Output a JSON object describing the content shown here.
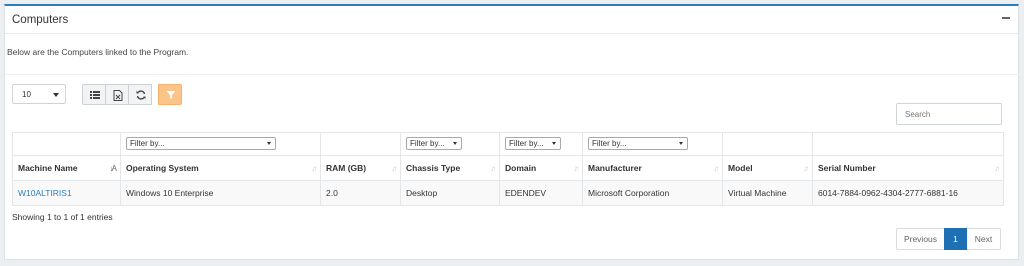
{
  "panel": {
    "title": "Computers",
    "intro": "Below are the Computers linked to the Program."
  },
  "toolbar": {
    "page_size": "10",
    "buttons": [
      "list-icon",
      "export-icon",
      "refresh-icon",
      "filter-icon"
    ],
    "filter_color": "#fbc58a"
  },
  "search": {
    "placeholder": "Search",
    "value": ""
  },
  "table": {
    "filters": [
      "",
      "Filter by...",
      "",
      "Filter by...",
      "Filter by...",
      "Filter by...",
      "",
      ""
    ],
    "columns": [
      "Machine Name",
      "Operating System",
      "RAM (GB)",
      "Chassis Type",
      "Domain",
      "Manufacturer",
      "Model",
      "Serial Number"
    ],
    "sorted_column": "Machine Name",
    "rows": [
      [
        "W10ALTIRIS1",
        "Windows 10 Enterprise",
        "2.0",
        "Desktop",
        "EDENDEV",
        "Microsoft Corporation",
        "Virtual Machine",
        "6014-7884-0962-4304-2777-6881-16"
      ]
    ]
  },
  "info": "Showing 1 to 1 of 1 entries",
  "pagination": {
    "prev": "Previous",
    "current": "1",
    "next": "Next"
  },
  "colors": {
    "accent": "#2a7fc1",
    "active_page": "#1f6fb5"
  }
}
